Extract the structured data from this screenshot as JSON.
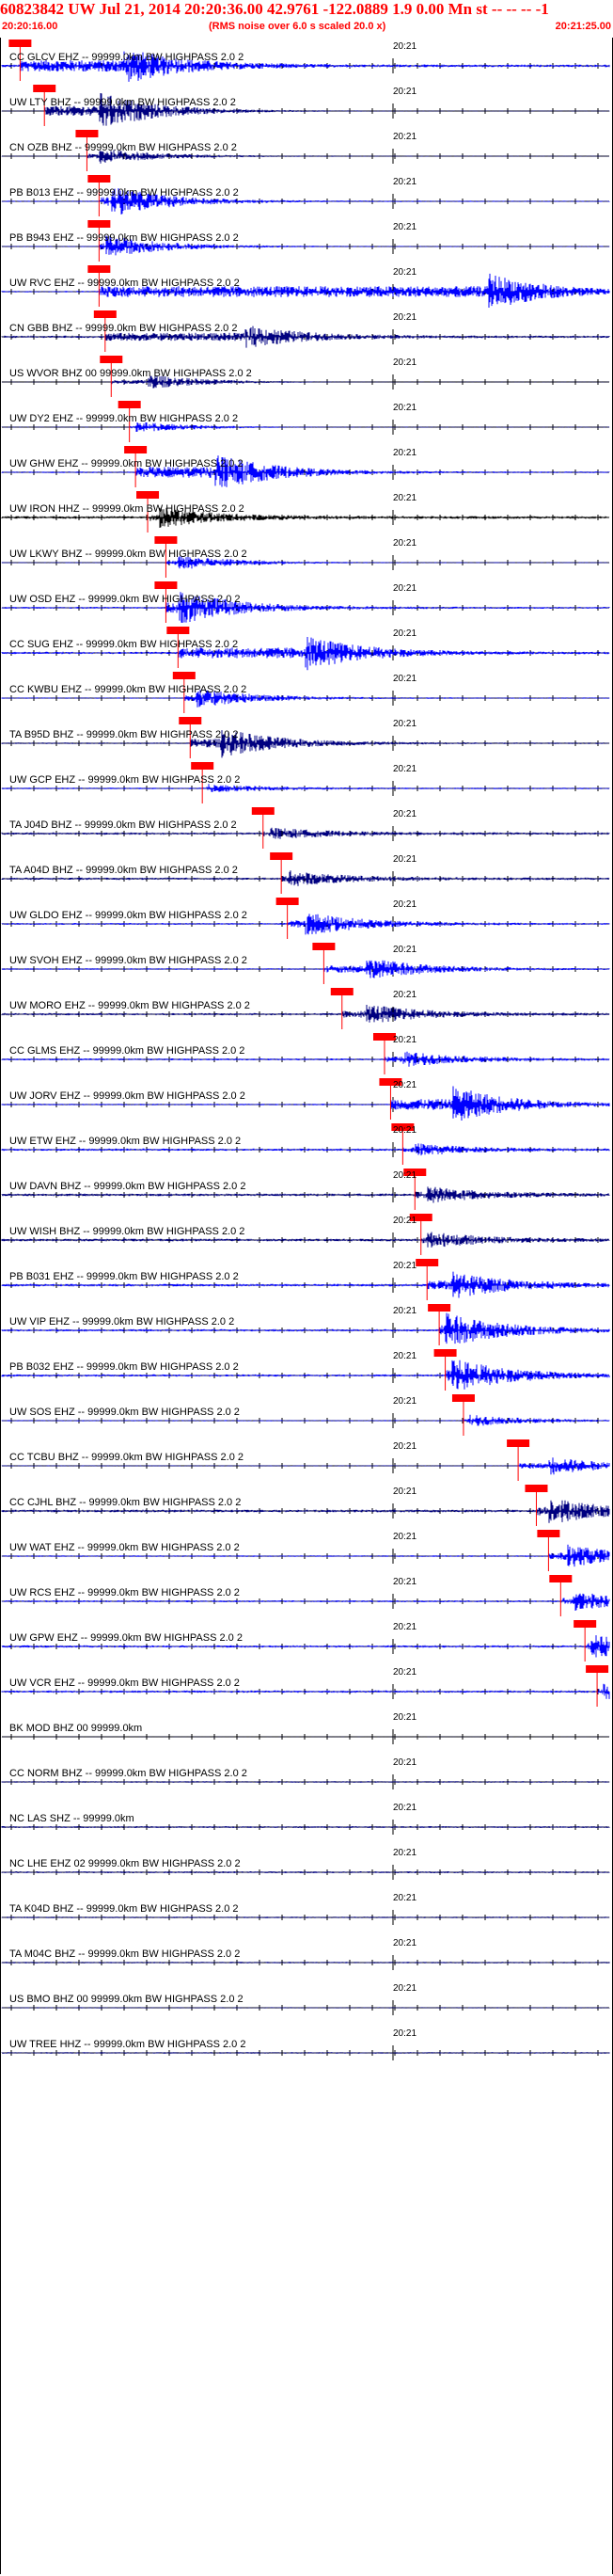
{
  "header": {
    "title": "60823842 UW Jul 21, 2014 20:20:36.00   42.9761 -122.0889  1.9 0.00 Mn st -- -- --  -1",
    "start_time": "20:20:16.00",
    "rms_note": "(RMS noise over 6.0 s scaled 20.0 x)",
    "end_time": "20:21:25.00"
  },
  "tick_label": "20:21",
  "colors": {
    "header_text": "#ff0000",
    "trace_blue": "#0000ff",
    "trace_navy": "#000080",
    "trace_black": "#000000",
    "pick_marker": "#ff0000",
    "baseline": "#000000"
  },
  "traces": [
    {
      "label": "CC GLCV EHZ -- 99999.0km BW  HIGHPASS  2.0  2",
      "pick": 0.03,
      "burst": 0.2,
      "amp": 0.95,
      "noise": 0.35,
      "color": "#0000ff"
    },
    {
      "label": "UW LTY BHZ -- 99999.0km BW  HIGHPASS  2.0  2",
      "pick": 0.07,
      "burst": 0.16,
      "amp": 1.0,
      "noise": 0.1,
      "color": "#000080"
    },
    {
      "label": "CN OZB BHZ -- 99999.0km BW  HIGHPASS  2.0  2",
      "pick": 0.14,
      "burst": 0.16,
      "amp": 0.4,
      "noise": 0.12,
      "color": "#000080"
    },
    {
      "label": "PB B013 EHZ -- 99999.0km BW  HIGHPASS  2.0  2",
      "pick": 0.16,
      "burst": 0.18,
      "amp": 0.8,
      "noise": 0.15,
      "color": "#0000ff"
    },
    {
      "label": "PB B943 EHZ -- 99999.0km BW  HIGHPASS  2.0  2",
      "pick": 0.16,
      "burst": 0.17,
      "amp": 0.6,
      "noise": 0.12,
      "color": "#0000ff"
    },
    {
      "label": "UW RVC EHZ -- 99999.0km BW  HIGHPASS  2.0  2",
      "pick": 0.16,
      "burst": 0.8,
      "amp": 1.0,
      "noise": 0.2,
      "color": "#0000ff"
    },
    {
      "label": "CN GBB BHZ -- 99999.0km BW  HIGHPASS  2.0  2",
      "pick": 0.17,
      "burst": 0.4,
      "amp": 0.6,
      "noise": 0.3,
      "color": "#000080"
    },
    {
      "label": "US WVOR BHZ 00 99999.0km BW  HIGHPASS  2.0  2",
      "pick": 0.18,
      "burst": 0.24,
      "amp": 0.4,
      "noise": 0.05,
      "color": "#000080"
    },
    {
      "label": "UW DY2 EHZ -- 99999.0km BW  HIGHPASS  2.0  2",
      "pick": 0.21,
      "burst": 0.22,
      "amp": 0.3,
      "noise": 0.05,
      "color": "#0000ff"
    },
    {
      "label": "UW GHW EHZ -- 99999.0km BW  HIGHPASS  2.0  2",
      "pick": 0.22,
      "burst": 0.35,
      "amp": 1.0,
      "noise": 0.2,
      "color": "#0000ff"
    },
    {
      "label": "UW IRON HHZ -- 99999.0km BW  HIGHPASS  2.0  2",
      "pick": 0.24,
      "burst": 0.26,
      "amp": 0.5,
      "noise": 0.35,
      "color": "#000000"
    },
    {
      "label": "UW LKWY BHZ -- 99999.0km BW  HIGHPASS  2.0  2",
      "pick": 0.27,
      "burst": 0.29,
      "amp": 0.4,
      "noise": 0.1,
      "color": "#0000ff"
    },
    {
      "label": "UW OSD EHZ -- 99999.0km BW  HIGHPASS  2.0  2",
      "pick": 0.27,
      "burst": 0.29,
      "amp": 0.9,
      "noise": 0.25,
      "color": "#0000ff"
    },
    {
      "label": "CC SUG EHZ -- 99999.0km BW  HIGHPASS  2.0  2",
      "pick": 0.29,
      "burst": 0.5,
      "amp": 0.9,
      "noise": 0.3,
      "color": "#0000ff"
    },
    {
      "label": "CC KWBU EHZ -- 99999.0km BW  HIGHPASS  2.0  2",
      "pick": 0.3,
      "burst": 0.32,
      "amp": 0.5,
      "noise": 0.15,
      "color": "#0000ff"
    },
    {
      "label": "TA B95D BHZ -- 99999.0km BW  HIGHPASS  2.0  2",
      "pick": 0.31,
      "burst": 0.36,
      "amp": 0.8,
      "noise": 0.2,
      "color": "#000080"
    },
    {
      "label": "UW GCP EHZ -- 99999.0km BW  HIGHPASS  2.0  2",
      "pick": 0.33,
      "burst": 0.34,
      "amp": 0.2,
      "noise": 0.2,
      "color": "#0000ff"
    },
    {
      "label": "TA J04D BHZ -- 99999.0km BW  HIGHPASS  2.0  2",
      "pick": 0.43,
      "burst": 0.44,
      "amp": 0.3,
      "noise": 0.3,
      "color": "#000080"
    },
    {
      "label": "TA A04D BHZ -- 99999.0km BW  HIGHPASS  2.0  2",
      "pick": 0.46,
      "burst": 0.47,
      "amp": 0.4,
      "noise": 0.3,
      "color": "#000080"
    },
    {
      "label": "UW GLDO EHZ -- 99999.0km BW  HIGHPASS  2.0  2",
      "pick": 0.47,
      "burst": 0.5,
      "amp": 0.6,
      "noise": 0.25,
      "color": "#0000ff"
    },
    {
      "label": "UW SVOH EHZ -- 99999.0km BW  HIGHPASS  2.0  2",
      "pick": 0.53,
      "burst": 0.6,
      "amp": 0.6,
      "noise": 0.2,
      "color": "#0000ff"
    },
    {
      "label": "UW MORO EHZ -- 99999.0km BW  HIGHPASS  2.0  2",
      "pick": 0.56,
      "burst": 0.6,
      "amp": 0.5,
      "noise": 0.3,
      "color": "#000080"
    },
    {
      "label": "CC GLMS EHZ -- 99999.0km BW  HIGHPASS  2.0  2",
      "pick": 0.63,
      "burst": 0.66,
      "amp": 0.4,
      "noise": 0.25,
      "color": "#0000ff"
    },
    {
      "label": "UW JORV EHZ -- 99999.0km BW  HIGHPASS  2.0  2",
      "pick": 0.64,
      "burst": 0.74,
      "amp": 1.0,
      "noise": 0.2,
      "color": "#0000ff"
    },
    {
      "label": "UW ETW EHZ -- 99999.0km BW  HIGHPASS  2.0  2",
      "pick": 0.66,
      "burst": 0.68,
      "amp": 0.3,
      "noise": 0.3,
      "color": "#0000ff"
    },
    {
      "label": "UW DAVN BHZ -- 99999.0km BW  HIGHPASS  2.0  2",
      "pick": 0.68,
      "burst": 0.7,
      "amp": 0.4,
      "noise": 0.35,
      "color": "#000080"
    },
    {
      "label": "UW WISH BHZ -- 99999.0km BW  HIGHPASS  2.0  2",
      "pick": 0.69,
      "burst": 0.7,
      "amp": 0.4,
      "noise": 0.35,
      "color": "#000080"
    },
    {
      "label": "PB B031 EHZ -- 99999.0km BW  HIGHPASS  2.0  2",
      "pick": 0.7,
      "burst": 0.74,
      "amp": 0.7,
      "noise": 0.35,
      "color": "#0000ff"
    },
    {
      "label": "UW VIP EHZ -- 99999.0km BW  HIGHPASS  2.0  2",
      "pick": 0.72,
      "burst": 0.73,
      "amp": 0.9,
      "noise": 0.3,
      "color": "#0000ff"
    },
    {
      "label": "PB B032 EHZ -- 99999.0km BW  HIGHPASS  2.0  2",
      "pick": 0.73,
      "burst": 0.74,
      "amp": 0.9,
      "noise": 0.3,
      "color": "#0000ff"
    },
    {
      "label": "UW SOS EHZ -- 99999.0km BW  HIGHPASS  2.0  2",
      "pick": 0.76,
      "burst": 0.77,
      "amp": 0.3,
      "noise": 0.15,
      "color": "#0000ff"
    },
    {
      "label": "CC TCBU BHZ -- 99999.0km BW  HIGHPASS  2.0  2",
      "pick": 0.85,
      "burst": 0.9,
      "amp": 0.5,
      "noise": 0.1,
      "color": "#0000ff"
    },
    {
      "label": "CC CJHL BHZ -- 99999.0km BW  HIGHPASS  2.0  2",
      "pick": 0.88,
      "burst": 0.9,
      "amp": 0.7,
      "noise": 0.35,
      "color": "#000080"
    },
    {
      "label": "UW WAT EHZ -- 99999.0km BW  HIGHPASS  2.0  2",
      "pick": 0.9,
      "burst": 0.93,
      "amp": 0.6,
      "noise": 0.2,
      "color": "#0000ff"
    },
    {
      "label": "UW RCS EHZ -- 99999.0km BW  HIGHPASS  2.0  2",
      "pick": 0.92,
      "burst": 0.94,
      "amp": 0.5,
      "noise": 0.25,
      "color": "#0000ff"
    },
    {
      "label": "UW GPW EHZ -- 99999.0km BW  HIGHPASS  2.0  2",
      "pick": 0.96,
      "burst": 0.97,
      "amp": 0.6,
      "noise": 0.3,
      "color": "#0000ff"
    },
    {
      "label": "UW VCR EHZ -- 99999.0km BW  HIGHPASS  2.0  2",
      "pick": 0.98,
      "burst": 0.99,
      "amp": 0.4,
      "noise": 0.3,
      "color": "#0000ff"
    },
    {
      "label": "BK MOD BHZ 00 99999.0km",
      "pick": null,
      "burst": null,
      "amp": 0.0,
      "noise": 0.03,
      "color": "#000080"
    },
    {
      "label": "CC NORM BHZ -- 99999.0km BW  HIGHPASS  2.0  2",
      "pick": null,
      "burst": null,
      "amp": 0.0,
      "noise": 0.2,
      "color": "#000080"
    },
    {
      "label": "NC LAS SHZ -- 99999.0km",
      "pick": null,
      "burst": null,
      "amp": 0.0,
      "noise": 0.25,
      "color": "#000080"
    },
    {
      "label": "NC LHE EHZ 02 99999.0km BW  HIGHPASS  2.0  2",
      "pick": null,
      "burst": null,
      "amp": 0.0,
      "noise": 0.25,
      "color": "#000080"
    },
    {
      "label": "TA K04D BHZ -- 99999.0km BW  HIGHPASS  2.0  2",
      "pick": null,
      "burst": null,
      "amp": 0.0,
      "noise": 0.2,
      "color": "#000080"
    },
    {
      "label": "TA M04C BHZ -- 99999.0km BW  HIGHPASS  2.0  2",
      "pick": null,
      "burst": null,
      "amp": 0.0,
      "noise": 0.2,
      "color": "#000080"
    },
    {
      "label": "US BMO BHZ 00 99999.0km BW  HIGHPASS  2.0  2",
      "pick": null,
      "burst": null,
      "amp": 0.0,
      "noise": 0.15,
      "color": "#000080"
    },
    {
      "label": "UW TREE HHZ -- 99999.0km BW  HIGHPASS  2.0  2",
      "pick": null,
      "burst": null,
      "amp": 0.0,
      "noise": 0.2,
      "color": "#000080"
    }
  ]
}
